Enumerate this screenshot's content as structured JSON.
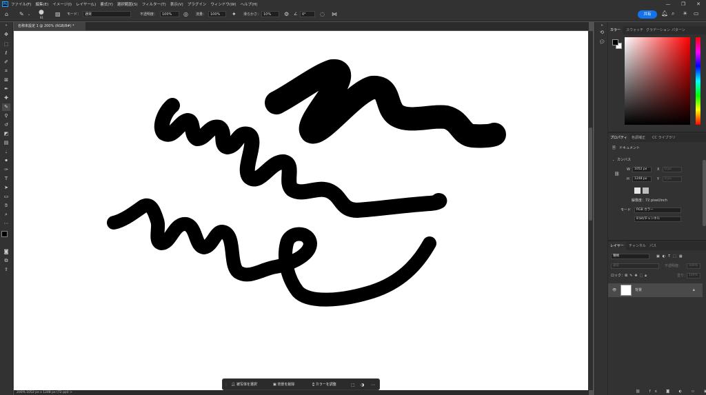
{
  "menubar": {
    "logo": "Ps",
    "items": [
      "ファイル(F)",
      "編集(E)",
      "イメージ(I)",
      "レイヤー(L)",
      "書式(Y)",
      "選択範囲(S)",
      "フィルター(T)",
      "表示(V)",
      "プラグイン",
      "ウィンドウ(W)",
      "ヘルプ(H)"
    ],
    "window_controls": [
      "—",
      "❐",
      "✕"
    ]
  },
  "options": {
    "brush_size": "81",
    "mode_label": "モード：",
    "mode_value": "通常",
    "opacity_label": "不透明度：",
    "opacity_value": "100%",
    "flow_label": "流量：",
    "flow_value": "100%",
    "smoothing_label": "滑らかさ：",
    "smoothing_value": "10%",
    "angle_value": "0°",
    "share_label": "共有"
  },
  "document": {
    "tab_title": "名称未設定 1 @ 200% (RGB/8#) *",
    "status": "200%     1052 px x 1248 px (72 ppi)     >"
  },
  "taskbar": {
    "select_subject": "被写体を選択",
    "remove_bg": "背景を削除",
    "color_adjust": "カラーを調整"
  },
  "color_panel": {
    "tabs": [
      "カラー",
      "スウォッチ",
      "グラデーション",
      "パターン"
    ],
    "foreground": "#000000",
    "background": "#ffffff"
  },
  "properties_panel": {
    "tabs": [
      "プロパティ",
      "色調補正",
      "CC ライブラリ"
    ],
    "doc_label": "ドキュメント",
    "canvas_heading": "カンバス",
    "w_label": "W",
    "w_value": "1052 px",
    "h_label": "H",
    "h_value": "1248 px",
    "x_label": "X",
    "x_value": "0 px",
    "y_label": "Y",
    "y_value": "0 px",
    "resolution": "解像度：72 pixel/inch",
    "mode_label": "モード",
    "mode_value": "RGB カラー",
    "bits_value": "8 bit/チャンネル"
  },
  "layers_panel": {
    "tabs": [
      "レイヤー",
      "チャンネル",
      "パス"
    ],
    "search_placeholder": "種類",
    "blend_mode": "通常",
    "opacity_label": "不透明度：",
    "opacity_value": "100%",
    "lock_label": "ロック：",
    "fill_label": "塗り：",
    "fill_value": "100%",
    "layer_name": "背景"
  }
}
